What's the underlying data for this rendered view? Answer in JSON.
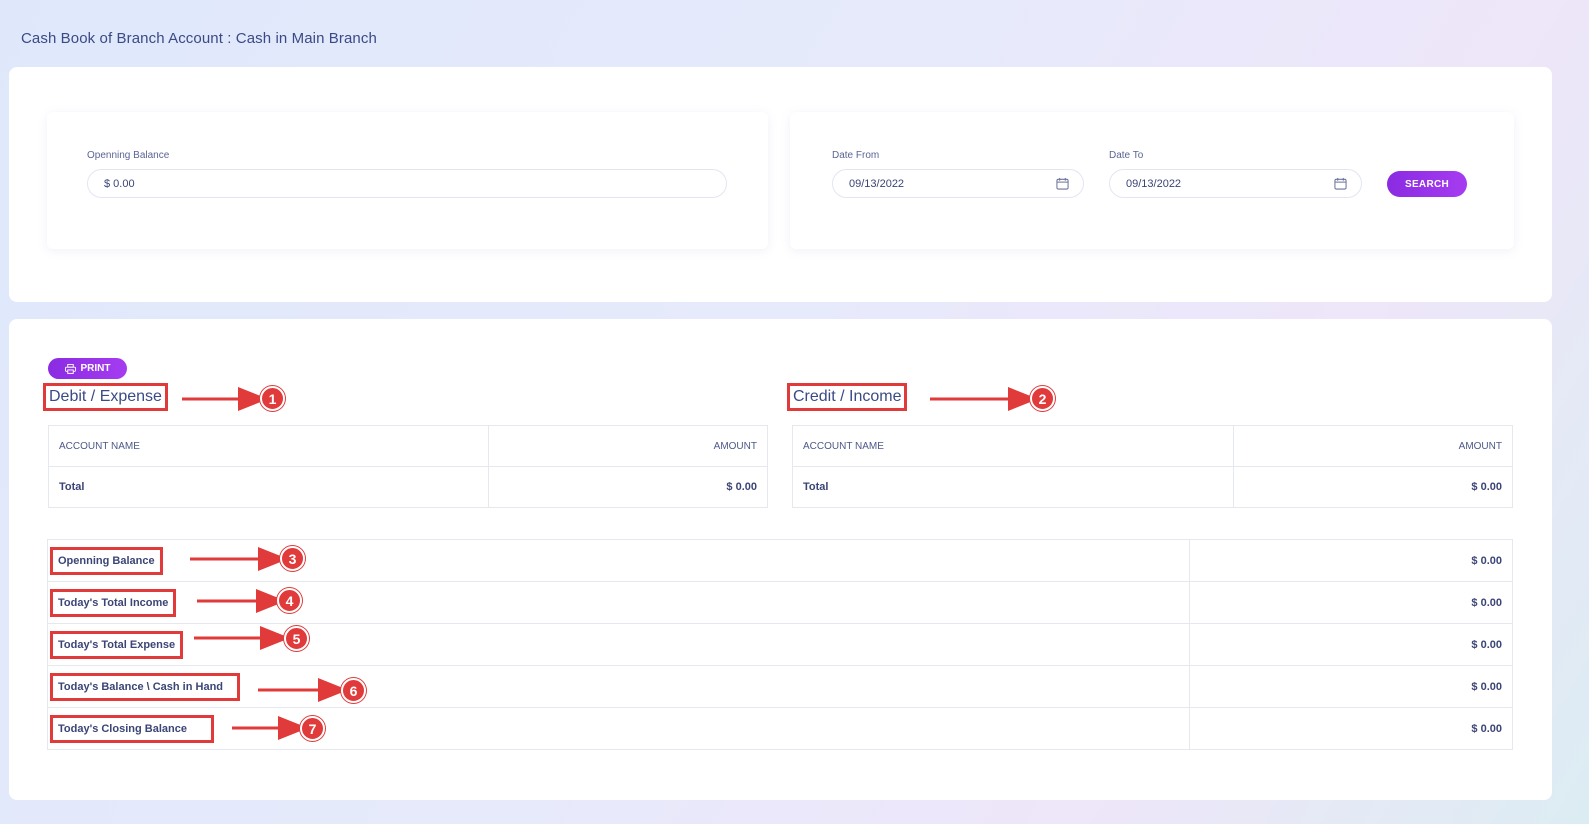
{
  "page": {
    "title": "Cash Book of Branch Account : Cash in Main Branch"
  },
  "filters": {
    "opening_label": "Openning Balance",
    "opening_value": "$ 0.00",
    "date_from_label": "Date From",
    "date_from_value": "09/13/2022",
    "date_to_label": "Date To",
    "date_to_value": "09/13/2022",
    "search_label": "SEARCH"
  },
  "report": {
    "print_label": "PRINT",
    "debit": {
      "heading": "Debit / Expense",
      "col_account": "ACCOUNT NAME",
      "col_amount": "AMOUNT",
      "total_label": "Total",
      "total_value": "$ 0.00"
    },
    "credit": {
      "heading": "Credit / Income",
      "col_account": "ACCOUNT NAME",
      "col_amount": "AMOUNT",
      "total_label": "Total",
      "total_value": "$ 0.00"
    },
    "summary": [
      {
        "label": "Openning Balance",
        "value": "$ 0.00"
      },
      {
        "label": "Today's Total Income",
        "value": "$ 0.00"
      },
      {
        "label": "Today's Total Expense",
        "value": "$ 0.00"
      },
      {
        "label": "Today's Balance \\ Cash in Hand",
        "value": "$ 0.00"
      },
      {
        "label": "Today's Closing Balance",
        "value": "$ 0.00"
      }
    ]
  },
  "annotations": [
    "1",
    "2",
    "3",
    "4",
    "5",
    "6",
    "7"
  ],
  "colors": {
    "accent": "#8a2be2",
    "annotation": "#e03a3a",
    "text": "#34407a"
  }
}
